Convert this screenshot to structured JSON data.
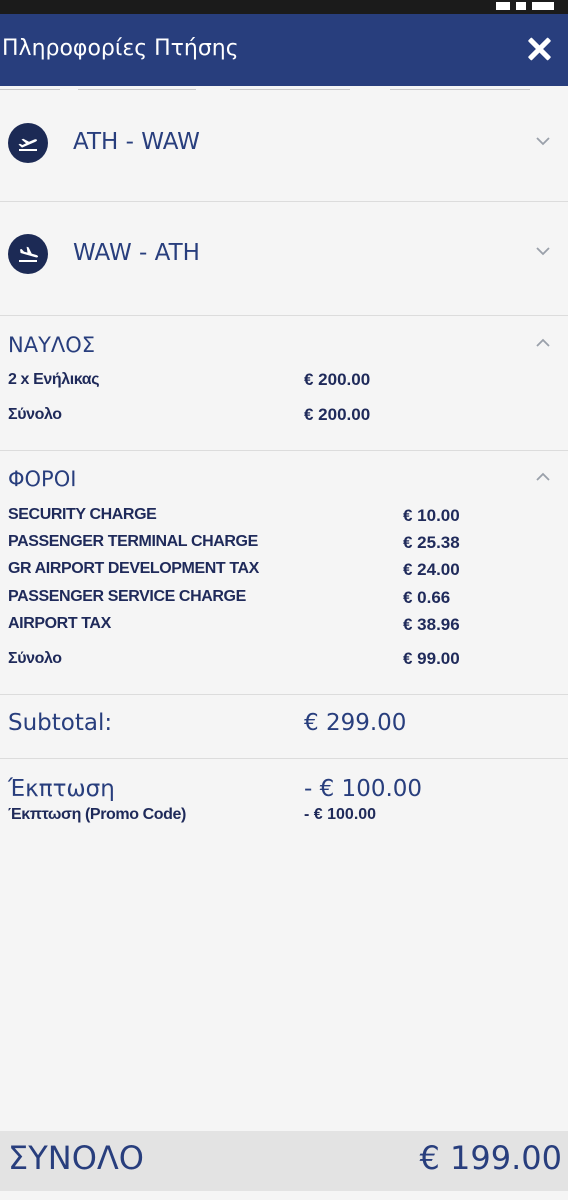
{
  "header": {
    "title": "Πληροφορίες Πτήσης",
    "close_icon": "close-icon"
  },
  "flights": [
    {
      "route": "ATH - WAW",
      "icon": "airplane-takeoff-icon"
    },
    {
      "route": "WAW - ATH",
      "icon": "airplane-landing-icon"
    }
  ],
  "fare": {
    "title": "ΝΑΥΛΟΣ",
    "rows": [
      {
        "label": "2 x Ενήλικας",
        "value": "€ 200.00"
      },
      {
        "label": "Σύνολο",
        "value": "€ 200.00"
      }
    ]
  },
  "taxes": {
    "title": "ΦΟΡΟΙ",
    "rows": [
      {
        "label": "SECURITY CHARGE",
        "value": "€ 10.00"
      },
      {
        "label": "PASSENGER TERMINAL CHARGE",
        "value": "€ 25.38"
      },
      {
        "label": "GR AIRPORT DEVELOPMENT TAX",
        "value": "€ 24.00"
      },
      {
        "label": "PASSENGER SERVICE CHARGE",
        "value": "€ 0.66"
      },
      {
        "label": "AIRPORT TAX",
        "value": "€ 38.96"
      },
      {
        "label": "Σύνολο",
        "value": "€ 99.00"
      }
    ]
  },
  "subtotal": {
    "label": "Subtotal:",
    "value": "€ 299.00"
  },
  "discount": {
    "label": "Έκπτωση",
    "value": "- € 100.00",
    "promo_label": "Έκπτωση (Promo Code)",
    "promo_value": "- € 100.00"
  },
  "total": {
    "label": "ΣΥΝΟΛΟ",
    "value": "€ 199.00"
  },
  "colors": {
    "header": "#283e7d",
    "icon_bg": "#1c2a55",
    "total_bar": "#e3e3e3"
  }
}
